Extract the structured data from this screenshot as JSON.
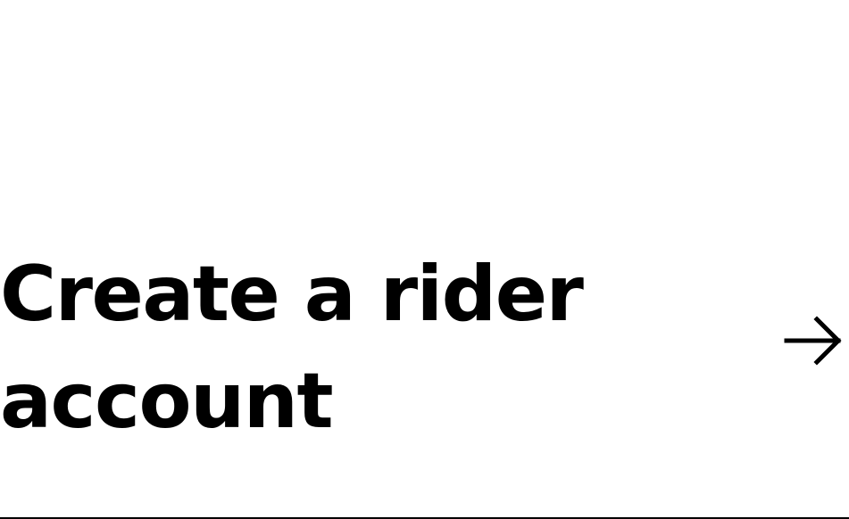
{
  "cta": {
    "title": "Create a rider account",
    "arrow_icon": "arrow-right-icon"
  },
  "colors": {
    "background": "#ffffff",
    "text": "#000000",
    "divider": "#000000"
  }
}
